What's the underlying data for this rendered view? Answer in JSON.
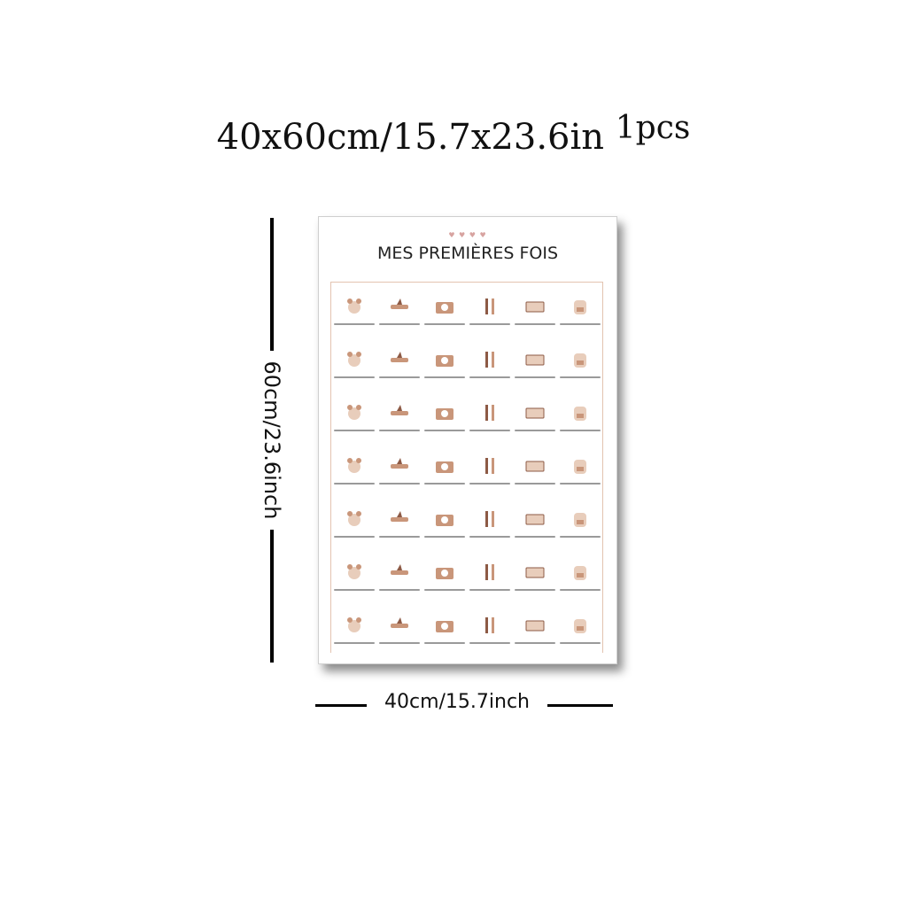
{
  "headline": {
    "size": "40x60cm/15.7x23.6in",
    "qty": "1pcs"
  },
  "dimensions": {
    "height": "60cm/23.6inch",
    "width": "40cm/15.7inch"
  },
  "poster": {
    "title": "MES PREMIÈRES FOIS",
    "hearts": "♥ ♥ ♥ ♥",
    "colors": {
      "accent": "#c9967a",
      "soft": "#e8cdbb",
      "dark": "#8d5a45"
    },
    "icons": [
      "mouse-icon",
      "airplane-icon",
      "camera-icon",
      "utensils-icon",
      "cinema-ticket-icon",
      "backpack-icon",
      "party-icon",
      "ferris-wheel-icon",
      "baby-face-icon",
      "cake-box-icon",
      "circus-tent-icon",
      "math-icon",
      "abc-icon",
      "bicycle-icon",
      "sailboat-icon",
      "cloud-icon",
      "train-icon",
      "angry-face-icon",
      "ice-skate-icon",
      "phone-icon",
      "egg-icon",
      "shower-icon",
      "shoes-icon",
      "birthday-cake-icon",
      "jacket-icon",
      "leaf-icon",
      "ski-icon",
      "bbq-icon",
      "bus-icon",
      "lips-icon",
      "mirror-icon",
      "pancake-icon",
      "piano-icon",
      "flower-icon",
      "theater-masks-icon",
      "graduation-cap-icon",
      "book-icon",
      "tree-icon",
      "heart-stamp-icon",
      "chef-hat-icon",
      "checklist-icon",
      "snowman-icon"
    ]
  }
}
